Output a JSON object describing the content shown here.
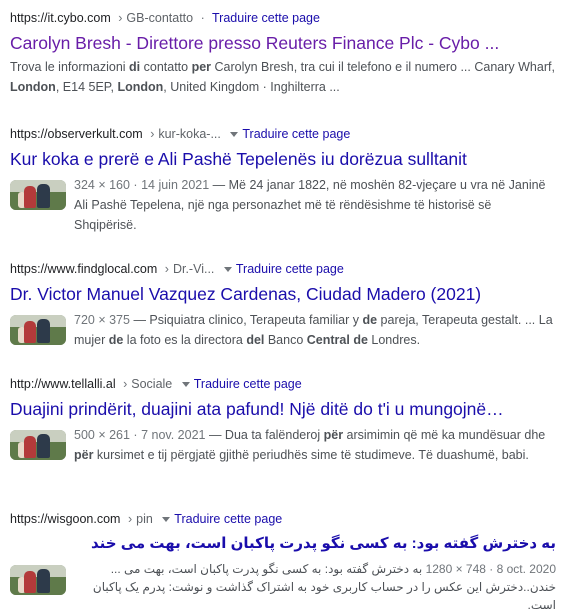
{
  "translate_label": "Traduire cette page",
  "results": [
    {
      "url": "https://it.cybo.com",
      "path": "GB-contatto",
      "title": "Carolyn Bresh - Direttore presso Reuters Finance Plc - Cybo ...",
      "snippet_parts": [
        "Trova le informazioni ",
        "di",
        " contatto ",
        "per",
        " Carolyn Bresh, tra cui il telefono e il numero ... Canary Wharf, ",
        "London",
        ", E14 5EP, ",
        "London",
        ", United Kingdom · Inghilterra ..."
      ]
    },
    {
      "url": "https://observerkult.com",
      "path": "kur-koka-...",
      "title": "Kur koka e prerë e Ali Pashë Tepelenës iu dorëzua sulltanit",
      "meta": "324 × 160 · 14 juin 2021",
      "snippet": " — Më 24 janar 1822, në moshën 82-vjeçare u vra në Janinë Ali Pashë Tepelena, një nga personazhet më të rëndësishme të historisë së Shqipërisë."
    },
    {
      "url": "https://www.findglocal.com",
      "path": "Dr.-Vi...",
      "title": "Dr. Victor Manuel Vazquez Cardenas, Ciudad Madero (2021)",
      "meta": "720 × 375",
      "snippet_parts": [
        " — Psiquiatra clinico, Terapeuta familiar y ",
        "de",
        " pareja, Terapeuta gestalt. ... La mujer ",
        "de",
        " la foto es la directora ",
        "del",
        " Banco ",
        "Central",
        " ",
        "de",
        " Londres."
      ]
    },
    {
      "url": "http://www.tellalli.al",
      "path": "Sociale",
      "title": "Duajini prindërit, duajini ata pafund! Një ditë do t'i u mungojnë…",
      "meta": "500 × 261 · 7 nov. 2021",
      "snippet_parts": [
        " — Dua ta falënderoj ",
        "për",
        " arsimimin që më ka mundësuar dhe ",
        "për",
        " kursimet e tij përgjatë gjithë periudhës sime të studimeve. Të duashumë, babi."
      ]
    },
    {
      "url": "https://wisgoon.com",
      "path": "pin",
      "title": "به دخترش گفته بود: به کسی نگو پدرت پاکبان است، بهت می خند",
      "meta": "1280 × 748 · 8 oct. 2020",
      "snippet": "به دخترش گفته بود: به کسی نگو پدرت پاکبان است، بهت می ... خندن..دخترش این عکس را در حساب کاربری خود به اشتراک گذاشت و نوشت: پدرم یک پاکبان است."
    }
  ]
}
